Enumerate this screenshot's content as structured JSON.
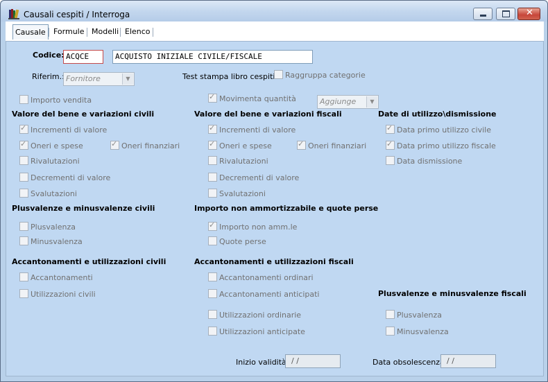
{
  "window": {
    "title": "Causali cespiti / Interroga"
  },
  "tabs": [
    "Causale",
    "Formule",
    "Modelli",
    "Elenco"
  ],
  "codice": {
    "label": "Codice:",
    "value": "ACQCE",
    "description": "ACQUISTO INIZIALE CIVILE/FISCALE"
  },
  "riferimento": {
    "label": "Riferim.:",
    "value": "Fornitore"
  },
  "test_stampa": {
    "label": "Test stampa libro cespiti:",
    "raggruppa": {
      "label": "Raggruppa categorie",
      "checked": false
    }
  },
  "importo_vendita": {
    "label": "Importo vendita",
    "checked": false
  },
  "movimenta": {
    "label": "Movimenta quantità",
    "checked": true,
    "combo_value": "Aggiunge"
  },
  "sections": {
    "civili": {
      "title": "Valore del bene e variazioni civili",
      "incrementi": {
        "label": "Incrementi di valore",
        "checked": true
      },
      "oneri_spese": {
        "label": "Oneri e spese",
        "checked": true
      },
      "oneri_finanziari": {
        "label": "Oneri finanziari",
        "checked": true
      },
      "rivalutazioni": {
        "label": "Rivalutazioni",
        "checked": false
      },
      "decrementi": {
        "label": "Decrementi di valore",
        "checked": false
      },
      "svalutazioni": {
        "label": "Svalutazioni",
        "checked": false
      }
    },
    "fiscali": {
      "title": "Valore del bene e variazioni fiscali",
      "incrementi": {
        "label": "Incrementi di valore",
        "checked": true
      },
      "oneri_spese": {
        "label": "Oneri e spese",
        "checked": true
      },
      "oneri_finanziari": {
        "label": "Oneri finanziari",
        "checked": true
      },
      "rivalutazioni": {
        "label": "Rivalutazioni",
        "checked": false
      },
      "decrementi": {
        "label": "Decrementi di valore",
        "checked": false
      },
      "svalutazioni": {
        "label": "Svalutazioni",
        "checked": false
      }
    },
    "date": {
      "title": "Date di utilizzo\\dismissione",
      "primo_civile": {
        "label": "Data primo utilizzo civile",
        "checked": true
      },
      "primo_fiscale": {
        "label": "Data primo utilizzo fiscale",
        "checked": true
      },
      "dismissione": {
        "label": "Data dismissione",
        "checked": false
      }
    },
    "plus_civili": {
      "title": "Plusvalenze e minusvalenze civili",
      "plusvalenza": {
        "label": "Plusvalenza",
        "checked": false
      },
      "minusvalenza": {
        "label": "Minusvalenza",
        "checked": false
      }
    },
    "non_amm": {
      "title": "Importo non ammortizzabile e quote perse",
      "importo": {
        "label": "Importo non amm.le",
        "checked": true
      },
      "quote_perse": {
        "label": "Quote perse",
        "checked": false
      }
    },
    "acc_civili": {
      "title": "Accantonamenti e utilizzazioni civili",
      "accantonamenti": {
        "label": "Accantonamenti",
        "checked": false
      },
      "utilizzazioni": {
        "label": "Utilizzazioni civili",
        "checked": false
      }
    },
    "acc_fiscali": {
      "title": "Accantonamenti e utilizzazioni fiscali",
      "acc_ordinari": {
        "label": "Accantonamenti ordinari",
        "checked": false
      },
      "acc_anticipati": {
        "label": "Accantonamenti anticipati",
        "checked": false
      },
      "util_ordinarie": {
        "label": "Utilizzazioni ordinarie",
        "checked": false
      },
      "util_anticipate": {
        "label": "Utilizzazioni anticipate",
        "checked": false
      }
    },
    "plus_fiscali": {
      "title": "Plusvalenze e minusvalenze fiscali",
      "plusvalenza": {
        "label": "Plusvalenza",
        "checked": false
      },
      "minusvalenza": {
        "label": "Minusvalenza",
        "checked": false
      }
    }
  },
  "footer": {
    "inizio_validita": {
      "label": "Inizio validità:",
      "value": "/ /"
    },
    "data_obsolescenza": {
      "label": "Data obsolescenza:",
      "value": "/ /"
    }
  },
  "icons": {
    "app": "books-icon",
    "minimize": "minimize-icon",
    "maximize": "maximize-icon",
    "close": "close-icon"
  }
}
